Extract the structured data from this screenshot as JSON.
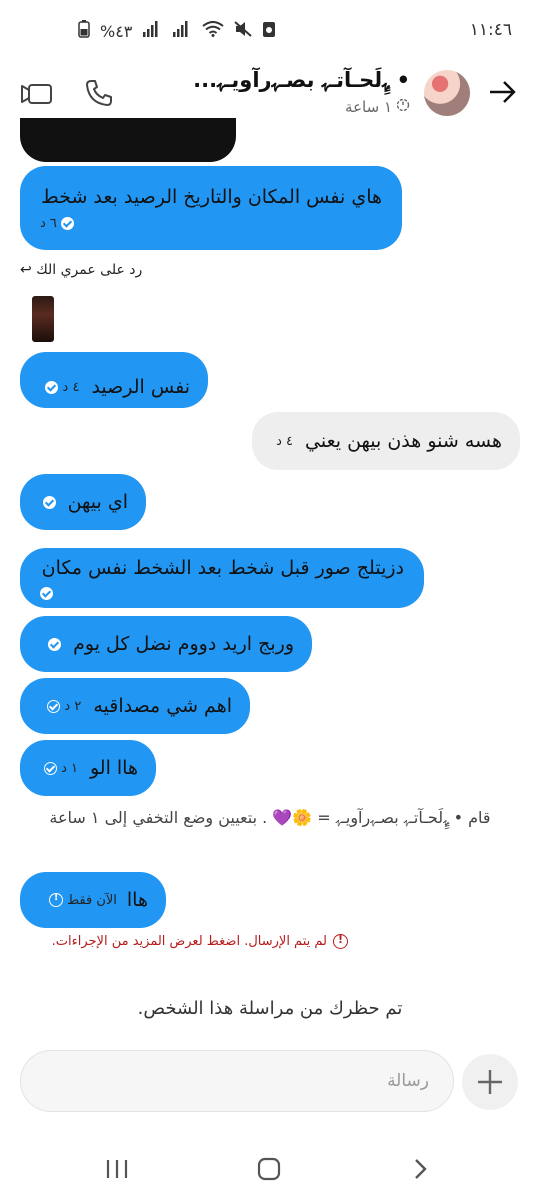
{
  "status_bar": {
    "time": "١١:٤٦",
    "battery": "%٤٣"
  },
  "header": {
    "chat_name": "• ﮩ‌ٍ‌ِلَحـآتـﮩ بصـﮩرآويـﮩ...",
    "subtitle": "١ ساعة",
    "icons": [
      "back-arrow-icon",
      "phone-icon",
      "video-icon",
      "timer-icon"
    ]
  },
  "messages": [
    {
      "id": "m1",
      "direction": "incoming",
      "text": "هاي نفس المكان والتاريخ الرصيد بعد شخط",
      "time": "٦ د"
    },
    {
      "id": "m2",
      "direction": "incoming",
      "text": "نفس الرصيد",
      "time": "٤ د"
    },
    {
      "id": "m3",
      "direction": "outgoing",
      "text": "هسه شنو هذن بيهن يعني",
      "time": "٤ د"
    },
    {
      "id": "m4",
      "direction": "incoming",
      "text": "اي بيهن",
      "time": ""
    },
    {
      "id": "m5",
      "direction": "incoming",
      "text": "دزيتلج صور قبل شخط بعد الشخط نفس مكان",
      "time": ""
    },
    {
      "id": "m6",
      "direction": "incoming",
      "text": "وربج اريد دووم نضل كل يوم",
      "time": ""
    },
    {
      "id": "m7",
      "direction": "incoming",
      "text": "اهم شي مصداقيه",
      "time": "٢ د"
    },
    {
      "id": "m8",
      "direction": "incoming",
      "text": "هاا الو",
      "time": "١ د"
    },
    {
      "id": "m9",
      "direction": "incoming",
      "text": "هاا",
      "time": "الآن فقط"
    }
  ],
  "reply_reference": "رد على عمري الك",
  "system_note": "قام • ﮩ‌ٍ‌ِلَحـآتـﮩ بصـﮩرآويـﮩ = 🌼💜 . بتعيين وضع التخفي إلى ١ ساعة",
  "fail_note": "لم يتم الإرسال. اضغط لعرض المزيد من الإجراءات.",
  "blocked_note": "تم حظرك من مراسلة هذا الشخص.",
  "composer": {
    "placeholder": "رسالة"
  },
  "colors": {
    "incoming_bubble": "#2196f3",
    "outgoing_bubble": "#eeeeee",
    "error": "#b71c1c"
  }
}
